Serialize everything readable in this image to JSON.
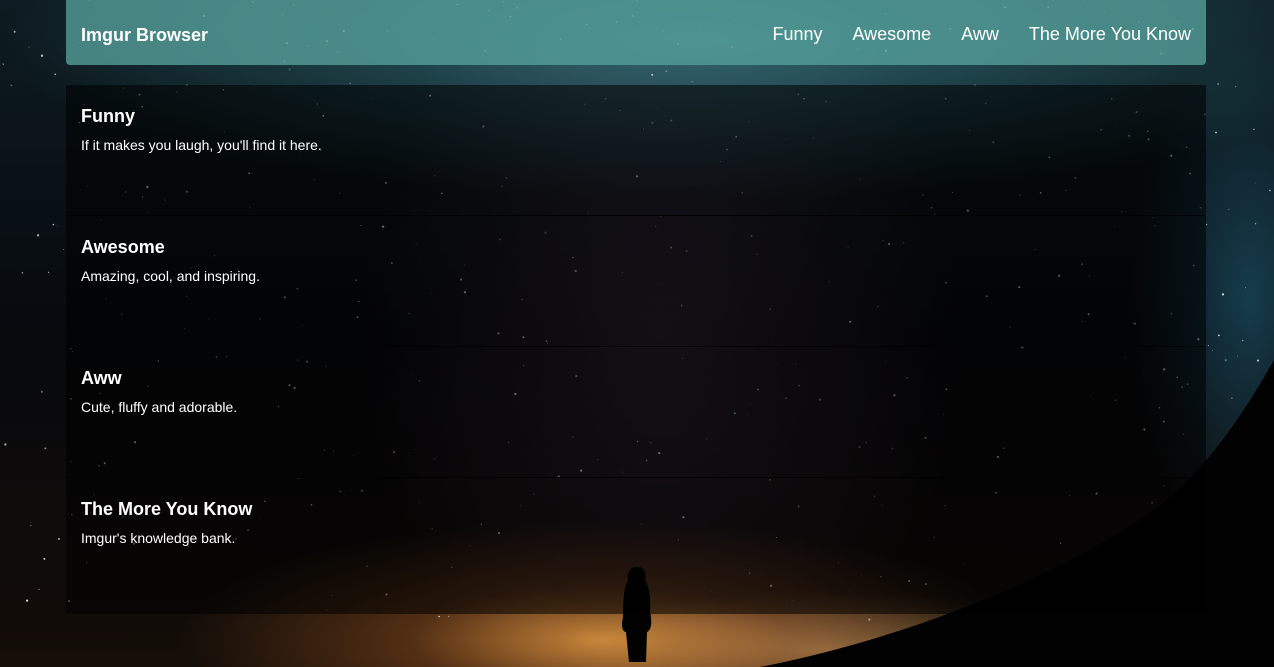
{
  "navbar": {
    "brand": "Imgur Browser",
    "links": [
      {
        "label": "Funny"
      },
      {
        "label": "Awesome"
      },
      {
        "label": "Aww"
      },
      {
        "label": "The More You Know"
      }
    ]
  },
  "sections": [
    {
      "title": "Funny",
      "description": "If it makes you laugh, you'll find it here."
    },
    {
      "title": "Awesome",
      "description": "Amazing, cool, and inspiring."
    },
    {
      "title": "Aww",
      "description": "Cute, fluffy and adorable."
    },
    {
      "title": "The More You Know",
      "description": "Imgur's knowledge bank."
    }
  ],
  "colors": {
    "navbar_bg": "#56a09b",
    "text": "#ffffff"
  }
}
